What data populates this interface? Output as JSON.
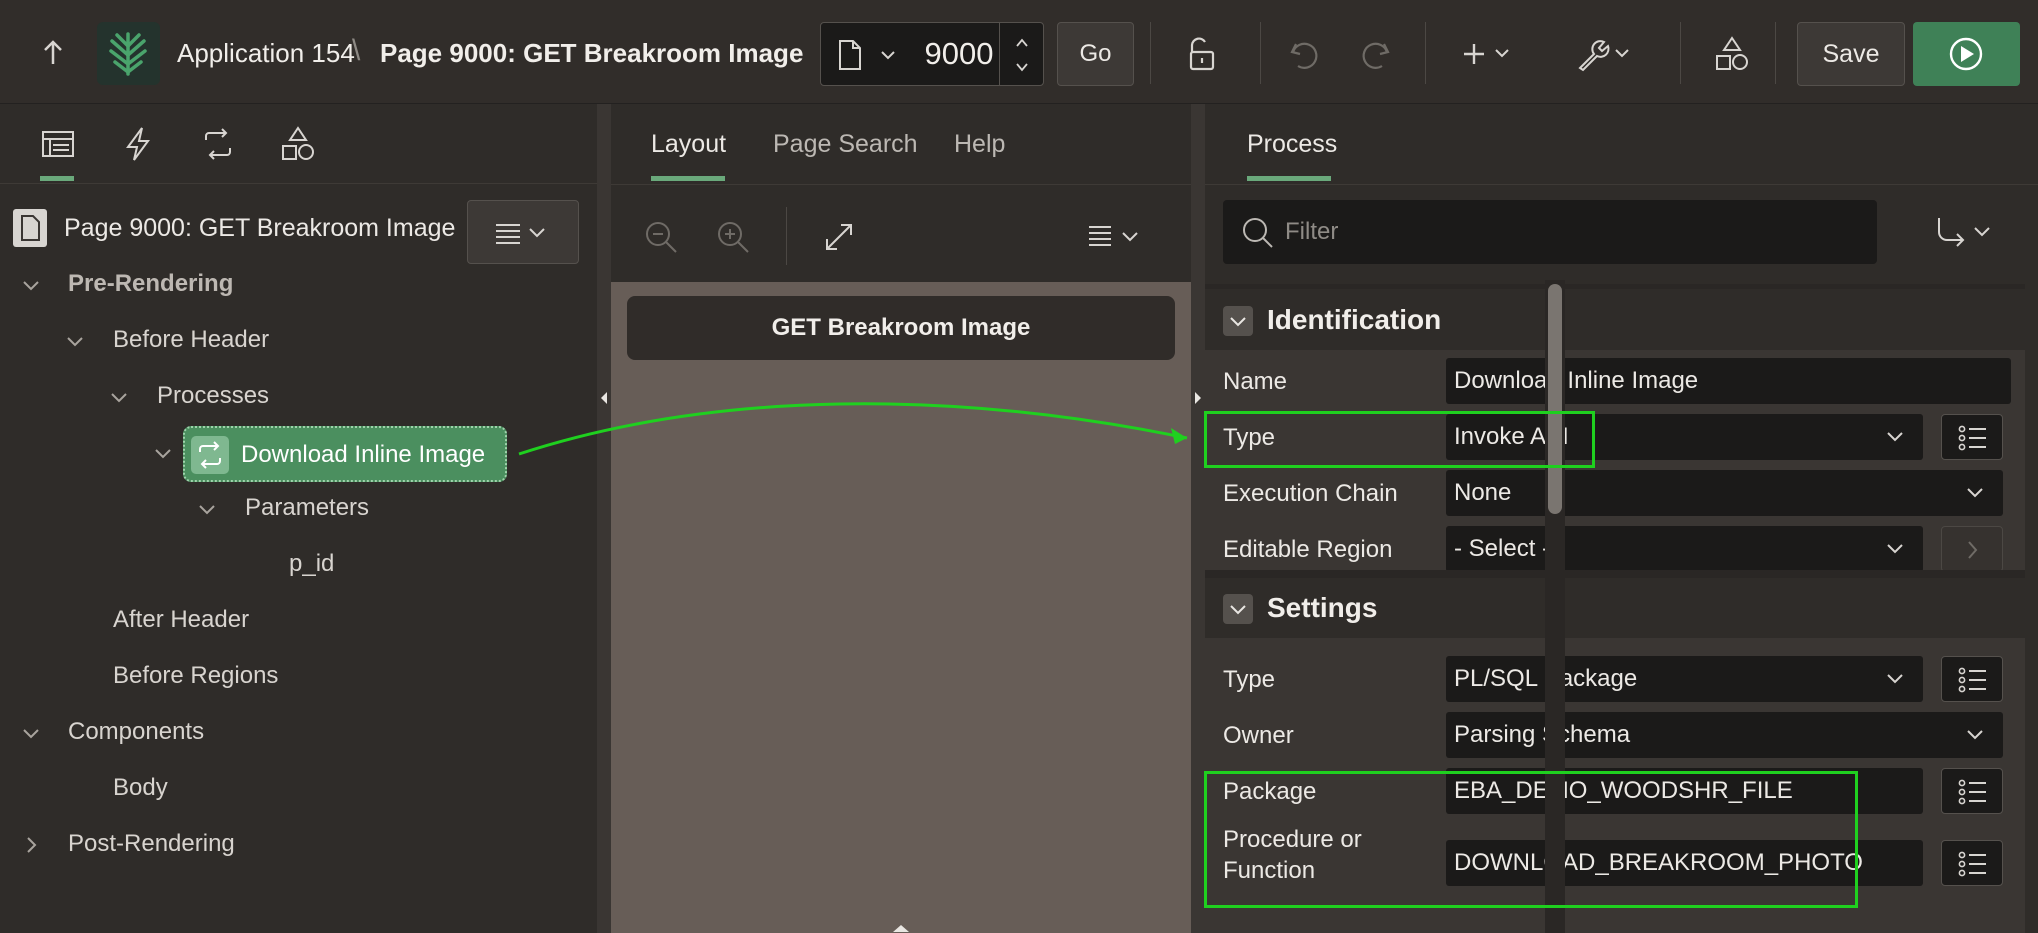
{
  "toolbar": {
    "app_name": "Application 154",
    "breadcrumb_sep": "\\",
    "page_title": "Page 9000: GET Breakroom Image",
    "page_number": "9000",
    "go_label": "Go",
    "save_label": "Save"
  },
  "tree": {
    "page_label": "Page 9000: GET Breakroom Image",
    "nodes": {
      "pre_rendering": "Pre-Rendering",
      "before_header": "Before Header",
      "processes": "Processes",
      "selected_process": "Download Inline Image",
      "parameters": "Parameters",
      "param_p_id": "p_id",
      "after_header": "After Header",
      "before_regions": "Before Regions",
      "components": "Components",
      "body": "Body",
      "post_rendering": "Post-Rendering"
    }
  },
  "center": {
    "tabs": [
      "Layout",
      "Page Search",
      "Help"
    ],
    "region_title": "GET Breakroom Image"
  },
  "properties": {
    "tab_label": "Process",
    "filter_placeholder": "Filter",
    "identification": {
      "title": "Identification",
      "name_label": "Name",
      "name_value": "Download Inline Image",
      "type_label": "Type",
      "type_value": "Invoke API",
      "chain_label": "Execution Chain",
      "chain_value": "None",
      "region_label": "Editable Region",
      "region_value": "- Select -"
    },
    "settings": {
      "title": "Settings",
      "type_label": "Type",
      "type_value": "PL/SQL Package",
      "owner_label": "Owner",
      "owner_value": "Parsing Schema",
      "package_label": "Package",
      "package_value": "EBA_DEMO_WOODSHR_FILE",
      "procedure_label_1": "Procedure or",
      "procedure_label_2": "Function",
      "procedure_value": "DOWNLOAD_BREAKROOM_PHOTO"
    }
  },
  "colors": {
    "accent_green": "#3f8157",
    "highlight_green": "#1fd01f",
    "tab_indicator": "#6aa97b"
  }
}
